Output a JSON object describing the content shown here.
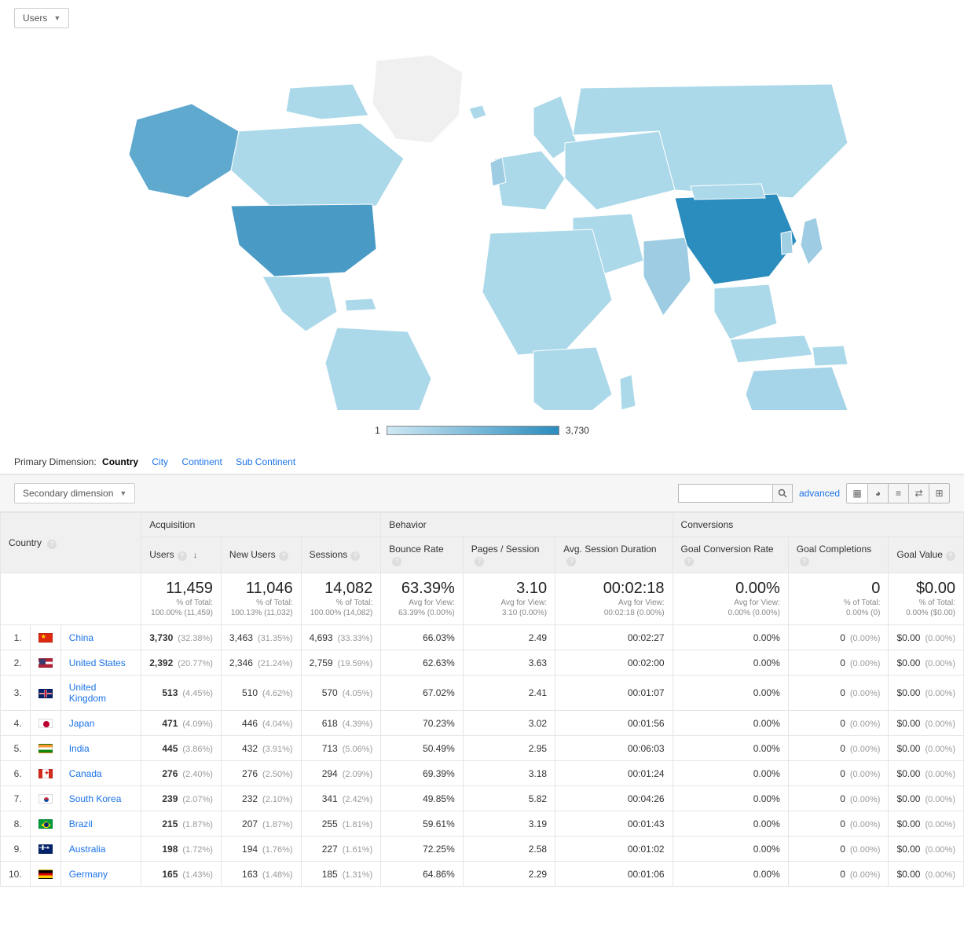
{
  "metric_dropdown": "Users",
  "legend": {
    "min": "1",
    "max": "3,730"
  },
  "primary_dimension": {
    "label": "Primary Dimension:",
    "active": "Country",
    "links": [
      "City",
      "Continent",
      "Sub Continent"
    ]
  },
  "secondary_dimension": "Secondary dimension",
  "advanced_link": "advanced",
  "column_groups": {
    "country": "Country",
    "acquisition": "Acquisition",
    "behavior": "Behavior",
    "conversions": "Conversions"
  },
  "columns": {
    "users": "Users",
    "new_users": "New Users",
    "sessions": "Sessions",
    "bounce_rate": "Bounce Rate",
    "pages_session": "Pages / Session",
    "avg_duration": "Avg. Session Duration",
    "goal_conv_rate": "Goal Conversion Rate",
    "goal_completions": "Goal Completions",
    "goal_value": "Goal Value"
  },
  "totals": {
    "users": {
      "big": "11,459",
      "sub1": "% of Total:",
      "sub2": "100.00% (11,459)"
    },
    "new_users": {
      "big": "11,046",
      "sub1": "% of Total:",
      "sub2": "100.13% (11,032)"
    },
    "sessions": {
      "big": "14,082",
      "sub1": "% of Total:",
      "sub2": "100.00% (14,082)"
    },
    "bounce_rate": {
      "big": "63.39%",
      "sub1": "Avg for View:",
      "sub2": "63.39% (0.00%)"
    },
    "pages_session": {
      "big": "3.10",
      "sub1": "Avg for View:",
      "sub2": "3.10 (0.00%)"
    },
    "avg_duration": {
      "big": "00:02:18",
      "sub1": "Avg for View:",
      "sub2": "00:02:18 (0.00%)"
    },
    "goal_conv_rate": {
      "big": "0.00%",
      "sub1": "Avg for View:",
      "sub2": "0.00% (0.00%)"
    },
    "goal_completions": {
      "big": "0",
      "sub1": "% of Total:",
      "sub2": "0.00% (0)"
    },
    "goal_value": {
      "big": "$0.00",
      "sub1": "% of Total:",
      "sub2": "0.00% ($0.00)"
    }
  },
  "rows": [
    {
      "idx": "1.",
      "flag": "cn",
      "country": "China",
      "users": "3,730",
      "users_pct": "(32.38%)",
      "new_users": "3,463",
      "new_users_pct": "(31.35%)",
      "sessions": "4,693",
      "sessions_pct": "(33.33%)",
      "bounce": "66.03%",
      "pages": "2.49",
      "dur": "00:02:27",
      "gcr": "0.00%",
      "gc": "0",
      "gc_pct": "(0.00%)",
      "gv": "$0.00",
      "gv_pct": "(0.00%)"
    },
    {
      "idx": "2.",
      "flag": "us",
      "country": "United States",
      "users": "2,392",
      "users_pct": "(20.77%)",
      "new_users": "2,346",
      "new_users_pct": "(21.24%)",
      "sessions": "2,759",
      "sessions_pct": "(19.59%)",
      "bounce": "62.63%",
      "pages": "3.63",
      "dur": "00:02:00",
      "gcr": "0.00%",
      "gc": "0",
      "gc_pct": "(0.00%)",
      "gv": "$0.00",
      "gv_pct": "(0.00%)"
    },
    {
      "idx": "3.",
      "flag": "gb",
      "country": "United Kingdom",
      "users": "513",
      "users_pct": "(4.45%)",
      "new_users": "510",
      "new_users_pct": "(4.62%)",
      "sessions": "570",
      "sessions_pct": "(4.05%)",
      "bounce": "67.02%",
      "pages": "2.41",
      "dur": "00:01:07",
      "gcr": "0.00%",
      "gc": "0",
      "gc_pct": "(0.00%)",
      "gv": "$0.00",
      "gv_pct": "(0.00%)"
    },
    {
      "idx": "4.",
      "flag": "jp",
      "country": "Japan",
      "users": "471",
      "users_pct": "(4.09%)",
      "new_users": "446",
      "new_users_pct": "(4.04%)",
      "sessions": "618",
      "sessions_pct": "(4.39%)",
      "bounce": "70.23%",
      "pages": "3.02",
      "dur": "00:01:56",
      "gcr": "0.00%",
      "gc": "0",
      "gc_pct": "(0.00%)",
      "gv": "$0.00",
      "gv_pct": "(0.00%)"
    },
    {
      "idx": "5.",
      "flag": "in",
      "country": "India",
      "users": "445",
      "users_pct": "(3.86%)",
      "new_users": "432",
      "new_users_pct": "(3.91%)",
      "sessions": "713",
      "sessions_pct": "(5.06%)",
      "bounce": "50.49%",
      "pages": "2.95",
      "dur": "00:06:03",
      "gcr": "0.00%",
      "gc": "0",
      "gc_pct": "(0.00%)",
      "gv": "$0.00",
      "gv_pct": "(0.00%)"
    },
    {
      "idx": "6.",
      "flag": "ca",
      "country": "Canada",
      "users": "276",
      "users_pct": "(2.40%)",
      "new_users": "276",
      "new_users_pct": "(2.50%)",
      "sessions": "294",
      "sessions_pct": "(2.09%)",
      "bounce": "69.39%",
      "pages": "3.18",
      "dur": "00:01:24",
      "gcr": "0.00%",
      "gc": "0",
      "gc_pct": "(0.00%)",
      "gv": "$0.00",
      "gv_pct": "(0.00%)"
    },
    {
      "idx": "7.",
      "flag": "kr",
      "country": "South Korea",
      "users": "239",
      "users_pct": "(2.07%)",
      "new_users": "232",
      "new_users_pct": "(2.10%)",
      "sessions": "341",
      "sessions_pct": "(2.42%)",
      "bounce": "49.85%",
      "pages": "5.82",
      "dur": "00:04:26",
      "gcr": "0.00%",
      "gc": "0",
      "gc_pct": "(0.00%)",
      "gv": "$0.00",
      "gv_pct": "(0.00%)"
    },
    {
      "idx": "8.",
      "flag": "br",
      "country": "Brazil",
      "users": "215",
      "users_pct": "(1.87%)",
      "new_users": "207",
      "new_users_pct": "(1.87%)",
      "sessions": "255",
      "sessions_pct": "(1.81%)",
      "bounce": "59.61%",
      "pages": "3.19",
      "dur": "00:01:43",
      "gcr": "0.00%",
      "gc": "0",
      "gc_pct": "(0.00%)",
      "gv": "$0.00",
      "gv_pct": "(0.00%)"
    },
    {
      "idx": "9.",
      "flag": "au",
      "country": "Australia",
      "users": "198",
      "users_pct": "(1.72%)",
      "new_users": "194",
      "new_users_pct": "(1.76%)",
      "sessions": "227",
      "sessions_pct": "(1.61%)",
      "bounce": "72.25%",
      "pages": "2.58",
      "dur": "00:01:02",
      "gcr": "0.00%",
      "gc": "0",
      "gc_pct": "(0.00%)",
      "gv": "$0.00",
      "gv_pct": "(0.00%)"
    },
    {
      "idx": "10.",
      "flag": "de",
      "country": "Germany",
      "users": "165",
      "users_pct": "(1.43%)",
      "new_users": "163",
      "new_users_pct": "(1.48%)",
      "sessions": "185",
      "sessions_pct": "(1.31%)",
      "bounce": "64.86%",
      "pages": "2.29",
      "dur": "00:01:06",
      "gcr": "0.00%",
      "gc": "0",
      "gc_pct": "(0.00%)",
      "gv": "$0.00",
      "gv_pct": "(0.00%)"
    }
  ],
  "chart_data": {
    "type": "choropleth-world",
    "metric": "Users",
    "scale": {
      "min": 1,
      "max": 3730
    },
    "countries": [
      {
        "name": "China",
        "value": 3730
      },
      {
        "name": "United States",
        "value": 2392
      },
      {
        "name": "United Kingdom",
        "value": 513
      },
      {
        "name": "Japan",
        "value": 471
      },
      {
        "name": "India",
        "value": 445
      },
      {
        "name": "Canada",
        "value": 276
      },
      {
        "name": "South Korea",
        "value": 239
      },
      {
        "name": "Brazil",
        "value": 215
      },
      {
        "name": "Australia",
        "value": 198
      },
      {
        "name": "Germany",
        "value": 165
      }
    ]
  }
}
